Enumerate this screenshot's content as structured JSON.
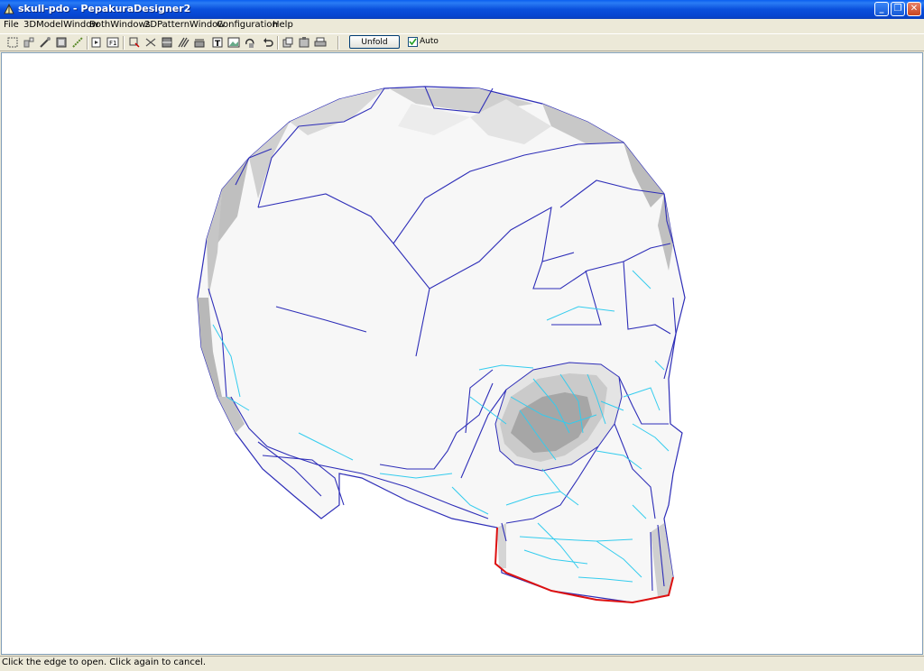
{
  "window": {
    "title": "skull-pdo - PepakuraDesigner2",
    "minimize_glyph": "_",
    "restore_glyph": "❐",
    "close_glyph": "✕"
  },
  "menu": {
    "items": [
      {
        "label": "File"
      },
      {
        "label": "3DModelWindow"
      },
      {
        "label": "BothWindows"
      },
      {
        "label": "2DPatternWindow"
      },
      {
        "label": "Configuration"
      },
      {
        "label": "Help"
      }
    ]
  },
  "toolbar": {
    "unfold_label": "Unfold",
    "auto_label": "Auto",
    "auto_checked": true,
    "icons": [
      "select-icon",
      "move-icon",
      "rotate-icon",
      "texture-icon",
      "edge-icon",
      "join-icon",
      "fit-icon",
      "edge-select-icon",
      "cut-icon",
      "face-icon",
      "flap-icon",
      "smooth-icon",
      "fold-line-icon",
      "text-icon",
      "image-icon",
      "rotate-part-icon",
      "undo-icon",
      "copy-icon",
      "paste-icon",
      "print-icon"
    ]
  },
  "status": {
    "message": "Click the edge to open. Click again to cancel."
  },
  "colors": {
    "title_bar": "#0a4fdc",
    "fold_mountain": "#2e2eb8",
    "fold_valley": "#33ccee",
    "open_edge": "#dd1111",
    "face_fill": "#f7f7f7"
  }
}
